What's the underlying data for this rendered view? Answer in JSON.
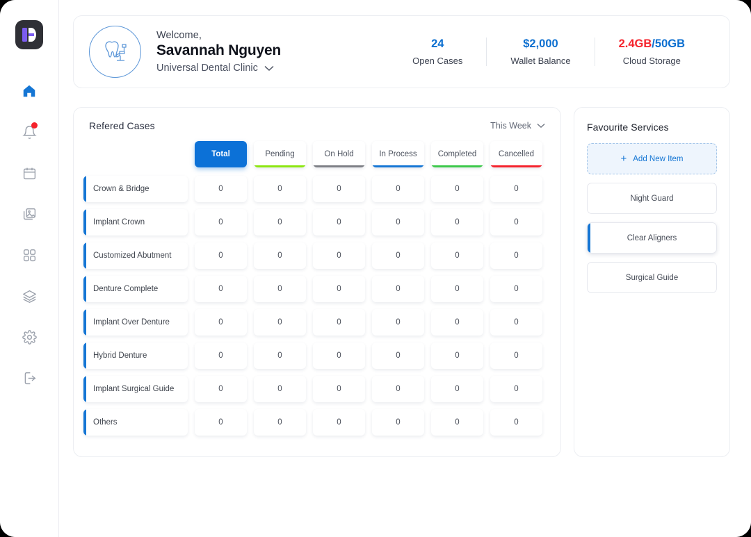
{
  "sidebar": {
    "logo_name": "app-logo",
    "items": [
      {
        "name": "home",
        "icon": "home-icon",
        "active": true,
        "badge": false
      },
      {
        "name": "notifications",
        "icon": "bell-icon",
        "active": false,
        "badge": true
      },
      {
        "name": "calendar",
        "icon": "calendar-icon",
        "active": false,
        "badge": false
      },
      {
        "name": "gallery",
        "icon": "images-icon",
        "active": false,
        "badge": false
      },
      {
        "name": "apps",
        "icon": "grid-icon",
        "active": false,
        "badge": false
      },
      {
        "name": "layers",
        "icon": "layers-icon",
        "active": false,
        "badge": false
      },
      {
        "name": "settings",
        "icon": "gear-icon",
        "active": false,
        "badge": false
      },
      {
        "name": "logout",
        "icon": "logout-icon",
        "active": false,
        "badge": false
      }
    ]
  },
  "header": {
    "avatar_icon": "dental-chair-icon",
    "greeting": "Welcome,",
    "user_name": "Savannah Nguyen",
    "clinic_name": "Universal Dental Clinic",
    "clinic_chevron": "chevron-down-icon",
    "stats": [
      {
        "value": "24",
        "label": "Open Cases",
        "color": "#0c6fd0"
      },
      {
        "value": "$2,000",
        "label": "Wallet Balance",
        "color": "#0c6fd0"
      },
      {
        "value_used": "2.4GB",
        "value_sep": "/",
        "value_total": "50GB",
        "label": "Cloud Storage",
        "color_used": "#f5232c",
        "color_total": "#0c6fd0"
      }
    ]
  },
  "cases": {
    "title": "Refered Cases",
    "period_filter": "This Week",
    "period_chevron": "chevron-down-icon",
    "tabs": [
      {
        "label": "Total",
        "active": true,
        "underline": ""
      },
      {
        "label": "Pending",
        "active": false,
        "underline": "#8ce610"
      },
      {
        "label": "On Hold",
        "active": false,
        "underline": "#7d7f85"
      },
      {
        "label": "In Process",
        "active": false,
        "underline": "#1576d4"
      },
      {
        "label": "Completed",
        "active": false,
        "underline": "#3cc84a"
      },
      {
        "label": "Cancelled",
        "active": false,
        "underline": "#f5232c"
      }
    ],
    "rows": [
      {
        "label": "Crown & Bridge",
        "values": [
          "0",
          "0",
          "0",
          "0",
          "0",
          "0"
        ]
      },
      {
        "label": "Implant Crown",
        "values": [
          "0",
          "0",
          "0",
          "0",
          "0",
          "0"
        ]
      },
      {
        "label": "Customized Abutment",
        "values": [
          "0",
          "0",
          "0",
          "0",
          "0",
          "0"
        ]
      },
      {
        "label": "Denture Complete",
        "values": [
          "0",
          "0",
          "0",
          "0",
          "0",
          "0"
        ]
      },
      {
        "label": "Implant Over Denture",
        "values": [
          "0",
          "0",
          "0",
          "0",
          "0",
          "0"
        ]
      },
      {
        "label": "Hybrid Denture",
        "values": [
          "0",
          "0",
          "0",
          "0",
          "0",
          "0"
        ]
      },
      {
        "label": "Implant Surgical Guide",
        "values": [
          "0",
          "0",
          "0",
          "0",
          "0",
          "0"
        ]
      },
      {
        "label": "Others",
        "values": [
          "0",
          "0",
          "0",
          "0",
          "0",
          "0"
        ]
      }
    ]
  },
  "favourites": {
    "title": "Favourite Services",
    "add_label": "Add New Item",
    "add_icon": "plus-icon",
    "items": [
      {
        "label": "Night Guard",
        "active": false
      },
      {
        "label": "Clear Aligners",
        "active": true
      },
      {
        "label": "Surgical Guide",
        "active": false
      }
    ]
  },
  "theme": {
    "accent_blue": "#1576d4",
    "active_tab_blue": "#0c71d7",
    "danger_red": "#f5232c"
  }
}
